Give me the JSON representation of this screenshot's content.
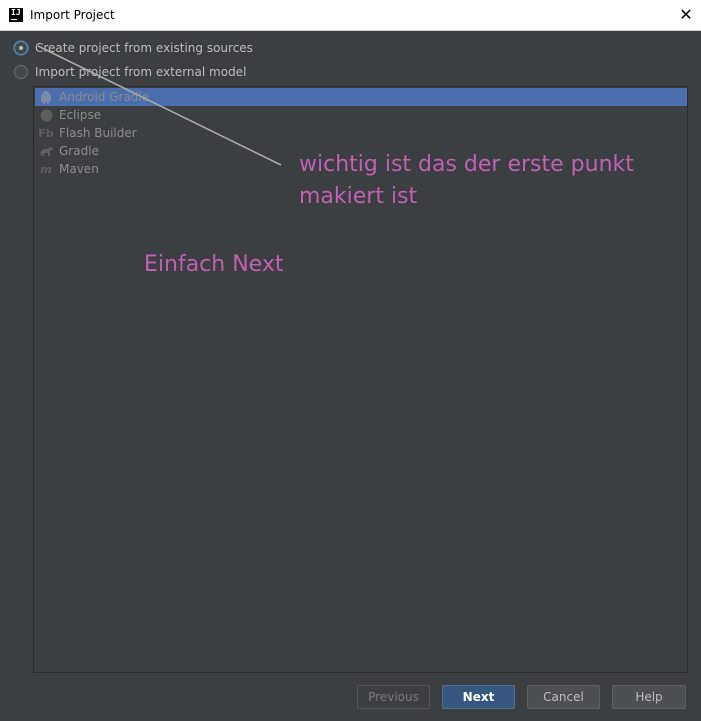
{
  "window": {
    "title": "Import Project",
    "icon_text": "IJ",
    "close_glyph": "✕"
  },
  "options": [
    {
      "label": "Create project from existing sources",
      "checked": true
    },
    {
      "label": "Import project from external model",
      "checked": false
    }
  ],
  "models": [
    {
      "label": "Android Gradle",
      "icon": "android-icon",
      "selected": true
    },
    {
      "label": "Eclipse",
      "icon": "eclipse-icon",
      "selected": false
    },
    {
      "label": "Flash Builder",
      "icon": "flash-builder-icon",
      "selected": false
    },
    {
      "label": "Gradle",
      "icon": "gradle-icon",
      "selected": false
    },
    {
      "label": "Maven",
      "icon": "maven-icon",
      "selected": false
    }
  ],
  "annotations": {
    "note_line1": "wichtig ist das der erste punkt",
    "note_line2": "makiert ist",
    "note_next": "Einfach Next",
    "color": "#c25fb5"
  },
  "buttons": {
    "previous": "Previous",
    "next": "Next",
    "cancel": "Cancel",
    "help": "Help"
  }
}
